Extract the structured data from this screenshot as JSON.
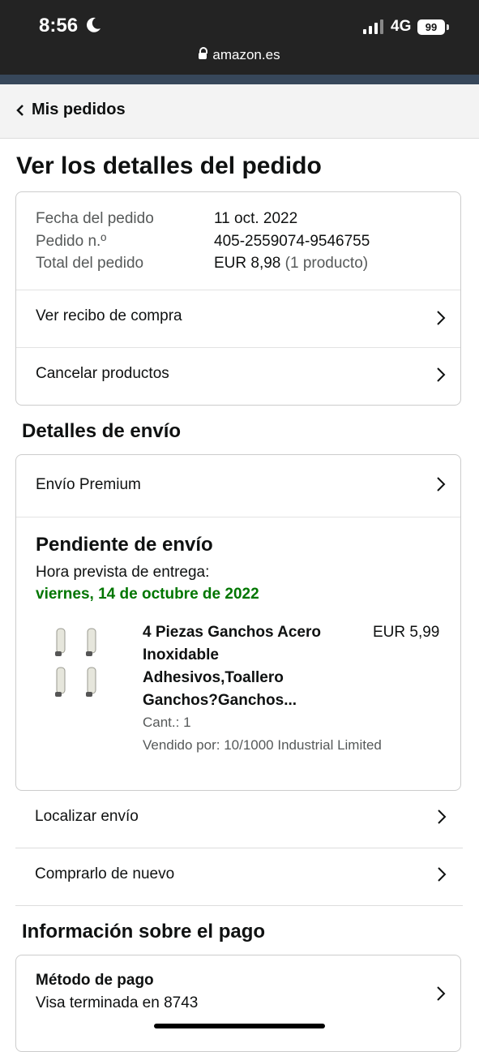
{
  "status_bar": {
    "time": "8:56",
    "network": "4G",
    "battery": "99",
    "url": "amazon.es"
  },
  "breadcrumb": {
    "label": "Mis pedidos"
  },
  "page": {
    "title": "Ver los detalles del pedido"
  },
  "order_summary": {
    "date_label": "Fecha del pedido",
    "date_value": "11 oct. 2022",
    "number_label": "Pedido n.º",
    "number_value": "405-2559074-9546755",
    "total_label": "Total del pedido",
    "total_value": "EUR 8,98",
    "total_note": "(1 producto)"
  },
  "order_actions": {
    "receipt": "Ver recibo de compra",
    "cancel": "Cancelar productos"
  },
  "shipping": {
    "section_title": "Detalles de envío",
    "method": "Envío Premium",
    "status": "Pendiente de envío",
    "eta_label": "Hora prevista de entrega:",
    "eta_date": "viernes, 14 de octubre de 2022",
    "product": {
      "title_lines": [
        "4 Piezas Ganchos Acero",
        "Inoxidable",
        "Adhesivos,Toallero",
        "Ganchos?Ganchos..."
      ],
      "price": "EUR 5,99",
      "qty": "Cant.: 1",
      "seller": "Vendido por: 10/1000 Industrial Limited"
    },
    "track": "Localizar envío",
    "buy_again": "Comprarlo de nuevo"
  },
  "payment": {
    "section_title": "Información sobre el pago",
    "method_label": "Método de pago",
    "method_value": "Visa terminada en 8743"
  },
  "icons": [
    "moon-icon",
    "signal-icon",
    "lock-icon",
    "chevron-left-icon",
    "chevron-right-icon",
    "product-image"
  ]
}
